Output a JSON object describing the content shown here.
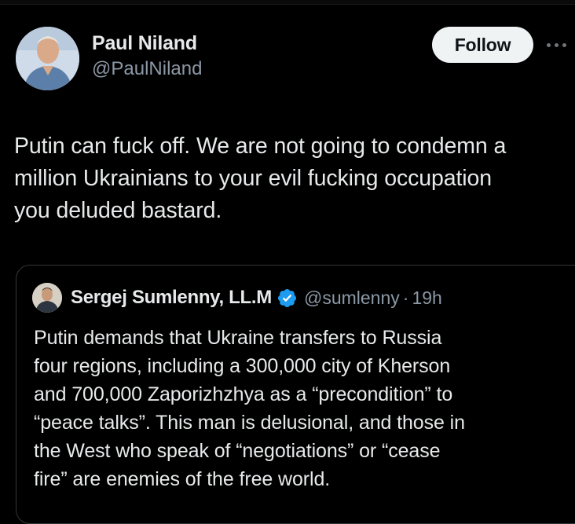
{
  "tweet": {
    "author_name": "Paul Niland",
    "author_handle": "@PaulNiland",
    "follow_label": "Follow",
    "text": "Putin can fuck off. We are not going to condemn a\nmillion Ukrainians to your evil fucking occupation\nyou deluded bastard."
  },
  "quote": {
    "author_name": "Sergej Sumlenny, LL.M",
    "author_handle": "@sumlenny",
    "separator": "·",
    "time": "19h",
    "text": "Putin demands that Ukraine transfers to Russia\nfour regions, including a 300,000 city of Kherson\nand 700,000 Zaporizhzhya as a “precondition” to\n“peace talks”. This man is delusional, and those in\nthe West who speak of “negotiations” or “cease\nfire” are enemies of the free world."
  },
  "colors": {
    "background": "#000000",
    "text_primary": "#e7e9ea",
    "text_secondary": "#8b98a5",
    "follow_bg": "#eff3f4",
    "verified": "#1d9bf0",
    "border": "#333639"
  },
  "icons": {
    "more": "more-horizontal-icon",
    "verified": "verified-badge-icon"
  }
}
